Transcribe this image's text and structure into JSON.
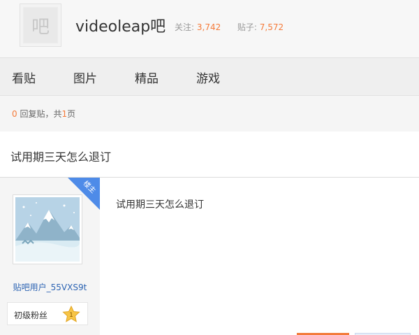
{
  "forum": {
    "logo_glyph": "吧",
    "name": "videoleap吧",
    "follow_label": "关注:",
    "follow_count": "3,742",
    "posts_label": "贴子:",
    "posts_count": "7,572"
  },
  "tabs": [
    "看贴",
    "图片",
    "精品",
    "游戏"
  ],
  "pager": {
    "reply_count": "0",
    "reply_text": " 回复贴，共",
    "page_count": "1",
    "page_suffix": "页"
  },
  "thread": {
    "title": "试用期三天怎么退订"
  },
  "post": {
    "badge": "楼主",
    "username": "贴吧用户_55VXS9t",
    "level_label": "初级粉丝",
    "level_number": "1",
    "content": "试用期三天怎么退订"
  },
  "colors": {
    "accent": "#f57b3a",
    "link": "#2d64b3",
    "badge": "#4e8be8"
  },
  "icons": {
    "star": "star-icon",
    "avatar": "mountain-landscape-avatar"
  }
}
